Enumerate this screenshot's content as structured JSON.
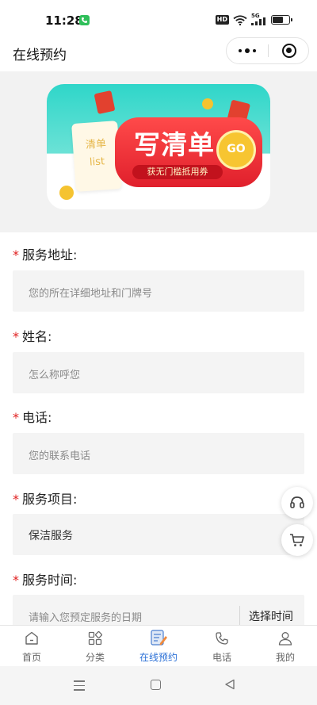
{
  "status_bar": {
    "time": "11:28",
    "hd": "HD",
    "network": "5G"
  },
  "nav_bar": {
    "title": "在线预约"
  },
  "banner": {
    "card_line1": "清单",
    "card_line2": "list",
    "title": "写清单",
    "subtitle": "获无门槛抵用券",
    "go": "GO",
    "colors": {
      "teal": "#2fd6c9",
      "red": "#e0202c",
      "gold": "#f7c531"
    }
  },
  "form": {
    "required_mark": "*",
    "address": {
      "label": "服务地址:",
      "placeholder": "您的所在详细地址和门牌号"
    },
    "name": {
      "label": "姓名:",
      "placeholder": "怎么称呼您"
    },
    "phone": {
      "label": "电话:",
      "placeholder": "您的联系电话"
    },
    "service": {
      "label": "服务项目:",
      "value": "保洁服务"
    },
    "time": {
      "label": "服务时间:",
      "placeholder": "请输入您预定服务的日期",
      "button": "选择时间"
    }
  },
  "floating": {
    "support_icon": "headset-icon",
    "cart_icon": "cart-icon"
  },
  "tabbar": {
    "items": [
      {
        "label": "首页",
        "icon": "home-icon",
        "active": false
      },
      {
        "label": "分类",
        "icon": "category-icon",
        "active": false
      },
      {
        "label": "在线预约",
        "icon": "booking-icon",
        "active": true
      },
      {
        "label": "电话",
        "icon": "phone-icon",
        "active": false
      },
      {
        "label": "我的",
        "icon": "user-icon",
        "active": false
      }
    ],
    "active_color": "#2a6fd6"
  }
}
